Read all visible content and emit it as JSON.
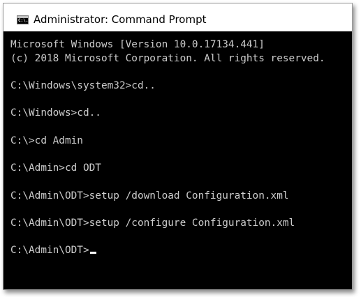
{
  "window": {
    "title": "Administrator: Command Prompt",
    "icon": "console-app-icon",
    "icon_glyph": "C:\\."
  },
  "console": {
    "background": "#000000",
    "text_color": "#cccccc",
    "lines": [
      "Microsoft Windows [Version 10.0.17134.441]",
      "(c) 2018 Microsoft Corporation. All rights reserved.",
      "",
      "C:\\Windows\\system32>cd..",
      "",
      "C:\\Windows>cd..",
      "",
      "C:\\>cd Admin",
      "",
      "C:\\Admin>cd ODT",
      "",
      "C:\\Admin\\ODT>setup /download Configuration.xml",
      "",
      "C:\\Admin\\ODT>setup /configure Configuration.xml",
      "",
      "C:\\Admin\\ODT>"
    ]
  }
}
